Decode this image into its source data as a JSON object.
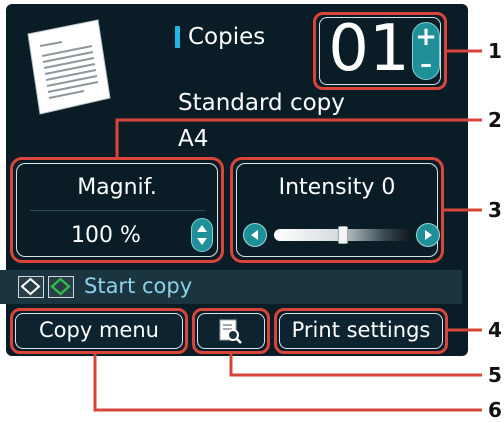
{
  "copies": {
    "label": "Copies",
    "count": "01",
    "increase_symbol": "+",
    "decrease_symbol": "–"
  },
  "copy_mode": "Standard copy",
  "paper_size": "A4",
  "magnification": {
    "label": "Magnif.",
    "value": "100 %"
  },
  "intensity": {
    "label": "Intensity 0",
    "level": 0,
    "range": [
      -4,
      4
    ]
  },
  "status": {
    "start_text": "Start copy"
  },
  "buttons": {
    "copy_menu": "Copy menu",
    "print_settings": "Print settings"
  },
  "callouts": [
    "1",
    "2",
    "3",
    "4",
    "5",
    "6"
  ],
  "colors": {
    "lcd_background": "#0a1d26",
    "highlight_red": "#d9453a",
    "accent_blue": "#22b6e6",
    "button_teal": "#1f8f98",
    "start_icon_green": "#2fbf4a"
  },
  "icons": {
    "document": "document-thumbnail-icon",
    "stop": "stop-icon",
    "start": "start-icon",
    "preview": "preview-magnifier-icon"
  }
}
